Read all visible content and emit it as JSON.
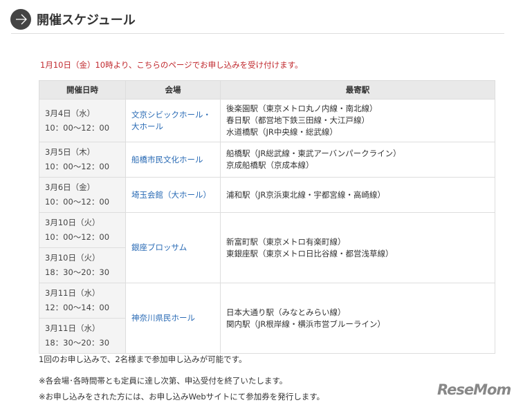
{
  "title": "開催スケジュール",
  "notice": "1月10日（金）10時より、こちらのページでお申し込みを受け付けます。",
  "headers": [
    "開催日時",
    "会場",
    "最寄駅"
  ],
  "rows": [
    {
      "d": "3月4日（水）",
      "t": "10：00〜12：00",
      "venue": "文京シビックホール・大ホール",
      "st": [
        "後楽園駅（東京メトロ丸ノ内線・南北線）",
        "春日駅（都営地下鉄三田線・大江戸線）",
        "水道橋駅（JR中央線・総武線）"
      ]
    },
    {
      "d": "3月5日（木）",
      "t": "10：00〜12：00",
      "venue": "船橋市民文化ホール",
      "st": [
        "船橋駅（JR総武線・東武アーバンパークライン）",
        "京成船橋駅（京成本線）"
      ]
    },
    {
      "d": "3月6日（金）",
      "t": "10：00〜12：00",
      "venue": "埼玉会館（大ホール）",
      "st": [
        "浦和駅（JR京浜東北線・宇都宮線・高崎線）"
      ]
    },
    {
      "d": "3月10日（火）",
      "t": "10：00〜12：00",
      "venue": "銀座ブロッサム",
      "st": [
        "新富町駅（東京メトロ有楽町線）",
        "東銀座駅（東京メトロ日比谷線・都営浅草線）"
      ]
    },
    {
      "d": "3月10日（火）",
      "t": "18：30〜20：30"
    },
    {
      "d": "3月11日（水）",
      "t": "12：00〜14：00",
      "venue": "神奈川県民ホール",
      "st": [
        "日本大通り駅（みなとみらい線）",
        "関内駅（JR根岸線・横浜市営ブルーライン）"
      ]
    },
    {
      "d": "3月11日（水）",
      "t": "18：30〜20：30"
    }
  ],
  "foot1": "1回のお申し込みで、2名様まで参加申し込みが可能です。",
  "foot2": "※各会場･各時間帯とも定員に達し次第、申込受付を終了いたします。",
  "foot3": "※お申し込みをされた方には、お申し込みWebサイトにて参加券を発行します。",
  "logo": "ReseMom"
}
